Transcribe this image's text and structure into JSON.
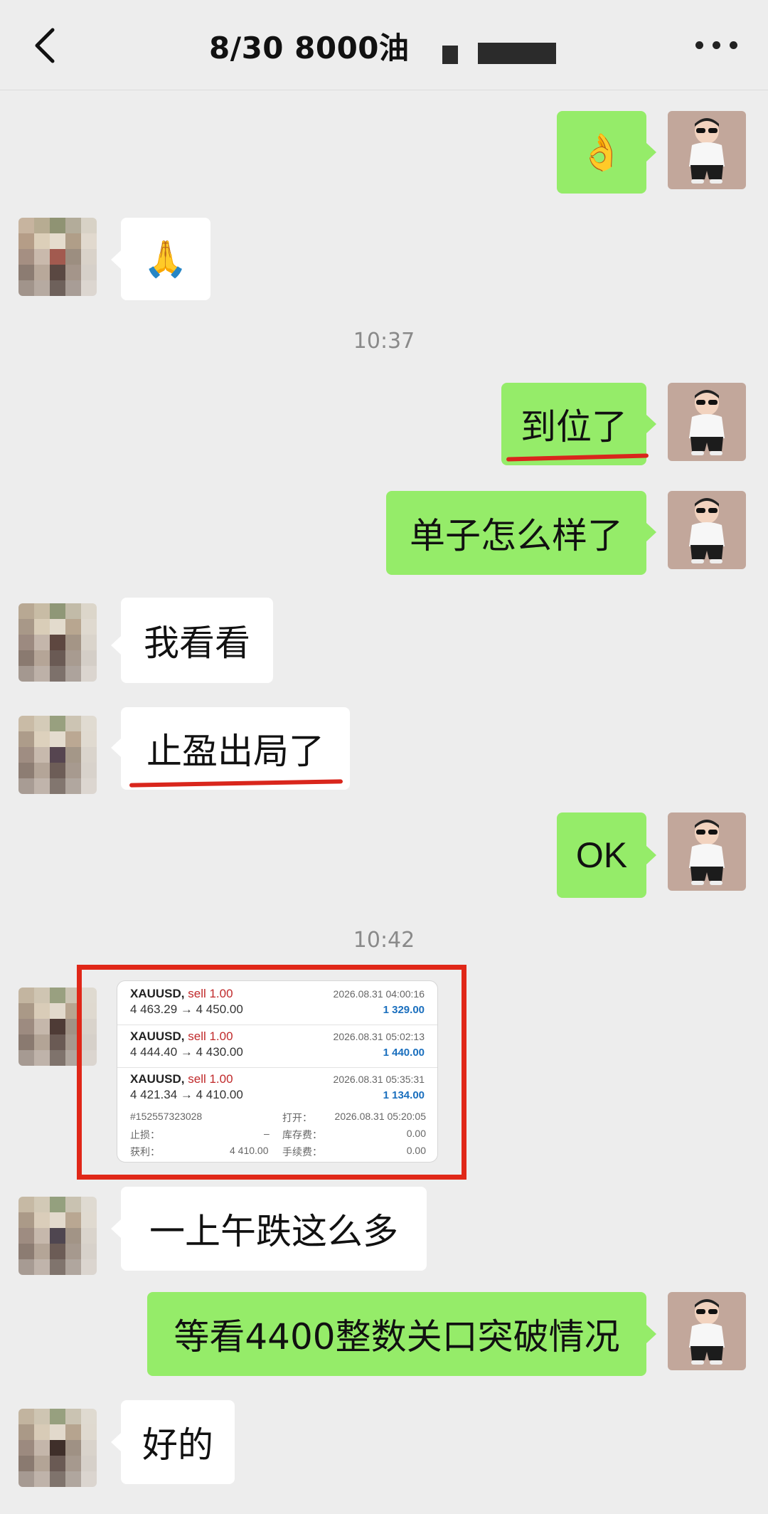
{
  "header": {
    "title": "8/30  8000油"
  },
  "timestamps": [
    "10:37",
    "10:42"
  ],
  "messages": [
    {
      "side": "me",
      "text": "👌"
    },
    {
      "side": "them",
      "text": "🙏"
    },
    {
      "side": "me",
      "text": "到位了"
    },
    {
      "side": "me",
      "text": "单子怎么样了"
    },
    {
      "side": "them",
      "text": "我看看"
    },
    {
      "side": "them",
      "text": "止盈出局了"
    },
    {
      "side": "me",
      "text": "OK"
    },
    {
      "side": "them",
      "text": "一上午跌这么多"
    },
    {
      "side": "me",
      "text": "等看4400整数关口突破情况"
    },
    {
      "side": "them",
      "text": "好的"
    }
  ],
  "trade_card": {
    "trades": [
      {
        "symbol": "XAUUSD,",
        "side": "sell 1.00",
        "price": "4 463.29 → 4 450.00",
        "date": "2026.08.31 04:00:16",
        "profit": "1 329.00"
      },
      {
        "symbol": "XAUUSD,",
        "side": "sell 1.00",
        "price": "4 444.40 → 4 430.00",
        "date": "2026.08.31 05:02:13",
        "profit": "1 440.00"
      },
      {
        "symbol": "XAUUSD,",
        "side": "sell 1.00",
        "price": "4 421.34 → 4 410.00",
        "date": "2026.08.31 05:35:31",
        "profit": "1 134.00"
      }
    ],
    "details": {
      "order_id": "#152557323028",
      "open_label": "打开：",
      "open_value": "2026.08.31 05:20:05",
      "sl_label": "止损：",
      "sl_value": "–",
      "swap_label": "库存费：",
      "swap_value": "0.00",
      "tp_label": "获利：",
      "tp_value": "4 410.00",
      "fee_label": "手续费：",
      "fee_value": "0.00"
    }
  },
  "colors": {
    "green_bubble": "#95ec69",
    "highlight": "#e02718",
    "profit_blue": "#1a6fbe",
    "sell_red": "#c0292a"
  }
}
